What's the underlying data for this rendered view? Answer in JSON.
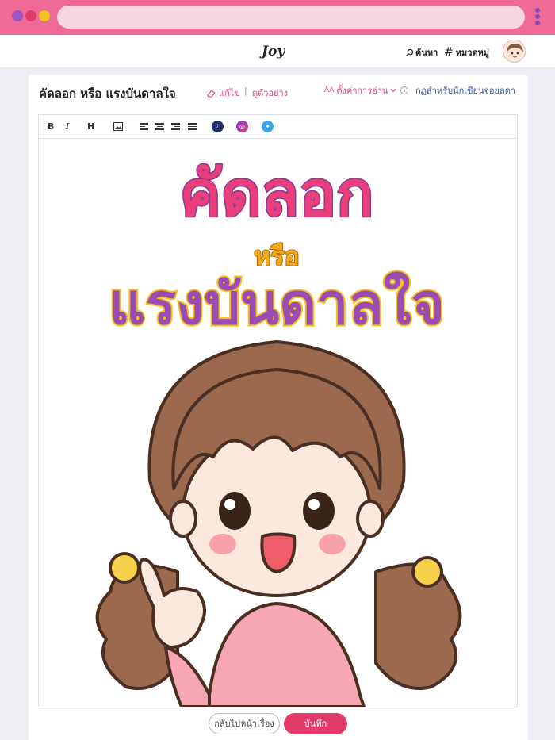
{
  "browser": {
    "accent_color": "#f06a97",
    "traffic_dots": [
      "#9a56c2",
      "#e23b6a",
      "#f4c21f"
    ]
  },
  "header": {
    "logo": "Joy",
    "search_label": "ค้นหา",
    "category_label": "หมวดหมู่"
  },
  "editor": {
    "doc_title": "คัดลอก หรือ แรงบันดาลใจ",
    "edit_label": "แก้ไข",
    "separator": "|",
    "preview_label": "ดูตัวอย่าง",
    "reading_settings_label": "ตั้งค่าการอ่าน",
    "writer_rules_label": "กฏสำหรับนักเขียนจอยลดา",
    "toolbar": {
      "bold": "B",
      "italic": "I",
      "heading": "H",
      "icons": [
        "image-icon",
        "align-left-icon",
        "align-center-icon",
        "align-right-icon",
        "align-justify-icon",
        "tiktok-icon",
        "instagram-icon",
        "twitter-icon"
      ]
    },
    "cover": {
      "headline": "คัดลอก",
      "connector": "หรือ",
      "subline": "แรงบันดาลใจ",
      "headline_color": "#ea3f7c",
      "connector_color": "#f4ac16",
      "subline_color": "#9b4cb2"
    }
  },
  "footer": {
    "back_label": "กลับไปหน้าเรื่อง",
    "save_label": "บันทึก",
    "save_color": "#e23b6a"
  }
}
